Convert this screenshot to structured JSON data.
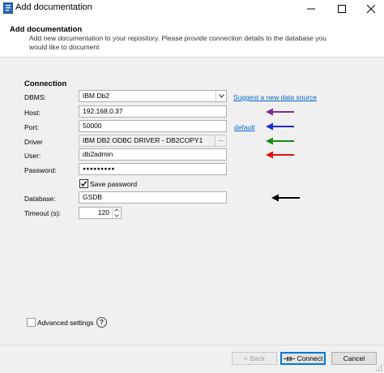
{
  "window": {
    "title": "Add documentation",
    "icon": "app-document-icon",
    "controls": [
      "minimize-icon",
      "maximize-icon",
      "close-icon"
    ]
  },
  "header": {
    "title": "Add documentation",
    "description": "Add new documentation to your repository. Please provide connection details to the database you would like to document"
  },
  "connection": {
    "section_title": "Connection",
    "dbms": {
      "label": "DBMS:",
      "value": "IBM Db2",
      "suggest_link": "Suggest a new data source"
    },
    "host": {
      "label": "Host:",
      "value": "192.168.0.37"
    },
    "port": {
      "label": "Port:",
      "value": "50000",
      "default_link": "default"
    },
    "driver": {
      "label": "Driver",
      "value": "IBM DB2 ODBC DRIVER - DB2COPY1",
      "browse": "···"
    },
    "user": {
      "label": "User:",
      "value": "db2admin"
    },
    "password": {
      "label": "Password:",
      "value": "●●●●●●●●●"
    },
    "save_password": {
      "label": "Save password",
      "checked": true
    },
    "database": {
      "label": "Database:",
      "value": "GSDB"
    },
    "timeout": {
      "label": "Timeout (s):",
      "value": "120"
    }
  },
  "annotations": {
    "arrow_colors": {
      "host": "#7b2d8e",
      "port": "#1f2bd0",
      "driver": "#1a8a1a",
      "user": "#e01010",
      "database": "#000000"
    }
  },
  "advanced": {
    "label": "Advanced settings",
    "checked": false,
    "help": "?"
  },
  "footer": {
    "back_label": "< Back",
    "connect_label": "Connect",
    "cancel_label": "Cancel"
  }
}
